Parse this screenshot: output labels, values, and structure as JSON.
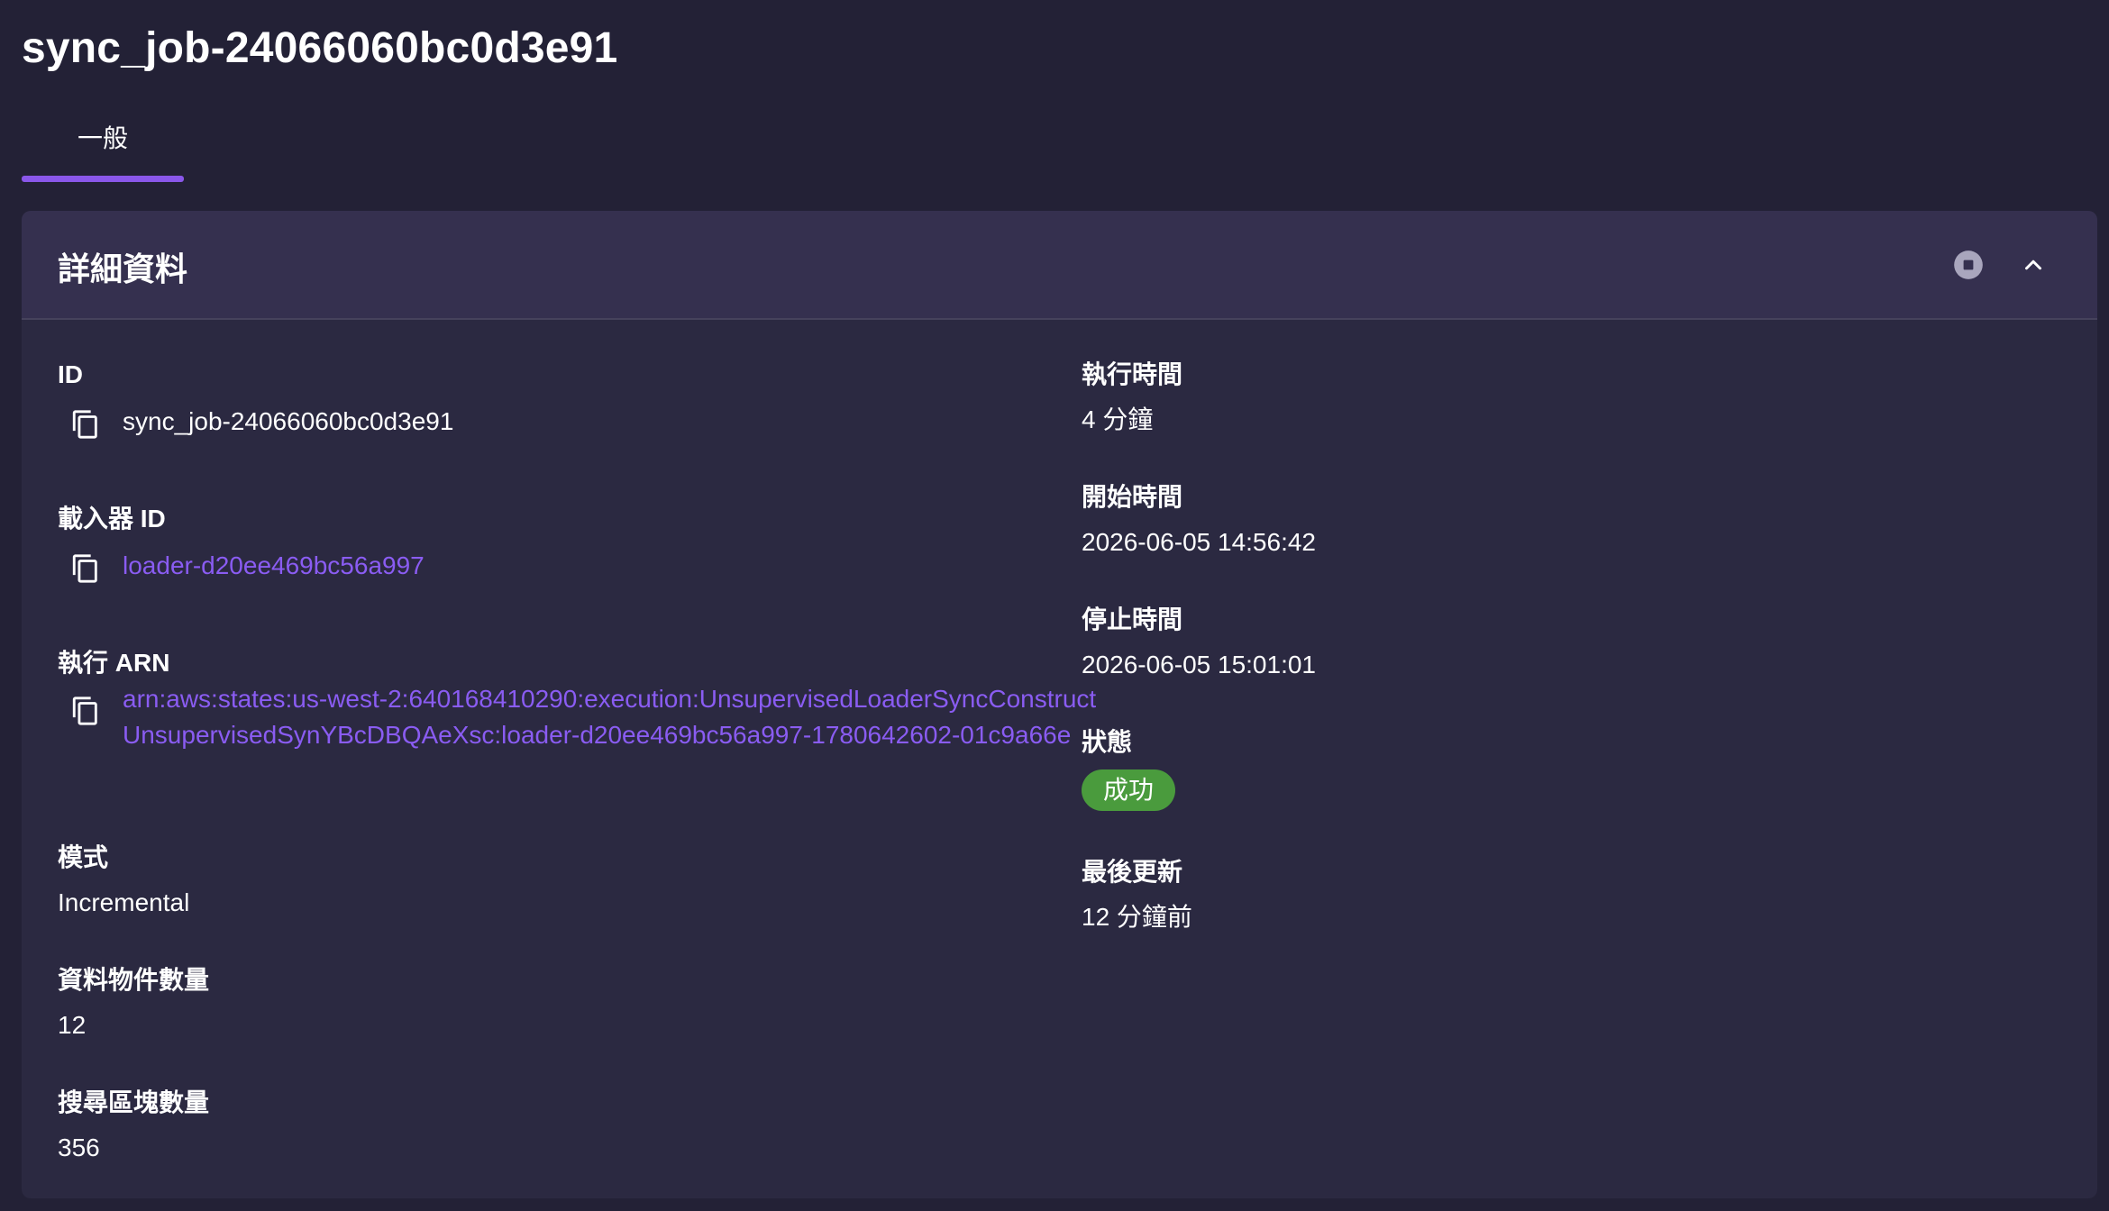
{
  "page": {
    "title": "sync_job-24066060bc0d3e91"
  },
  "tabs": [
    {
      "label": "一般"
    }
  ],
  "card": {
    "title": "詳細資料",
    "stop_icon": "stop-circle-icon",
    "collapse_icon": "chevron-up-icon"
  },
  "fields": {
    "id": {
      "label": "ID",
      "value": "sync_job-24066060bc0d3e91"
    },
    "loader_id": {
      "label": "載入器 ID",
      "value": "loader-d20ee469bc56a997"
    },
    "arn": {
      "label": "執行 ARN",
      "value": "arn:aws:states:us-west-2:640168410290:execution:UnsupervisedLoaderSyncConstructUnsupervisedSynYBcDBQAeXsc:loader-d20ee469bc56a997-1780642602-01c9a66e"
    },
    "mode": {
      "label": "模式",
      "value": "Incremental"
    },
    "data_object_count": {
      "label": "資料物件數量",
      "value": "12"
    },
    "search_chunk_count": {
      "label": "搜尋區塊數量",
      "value": "356"
    },
    "duration": {
      "label": "執行時間",
      "value": "4 分鐘"
    },
    "start_time": {
      "label": "開始時間",
      "value": "2026-06-05 14:56:42"
    },
    "stop_time": {
      "label": "停止時間",
      "value": "2026-06-05 15:01:01"
    },
    "status": {
      "label": "狀態",
      "value": "成功",
      "color": "#4a9b3d"
    },
    "last_updated": {
      "label": "最後更新",
      "value": "12 分鐘前"
    }
  },
  "colors": {
    "background": "#232136",
    "card": "#2b2941",
    "card_header": "#35304f",
    "accent": "#8a57ea",
    "link": "#8a5cf2"
  }
}
